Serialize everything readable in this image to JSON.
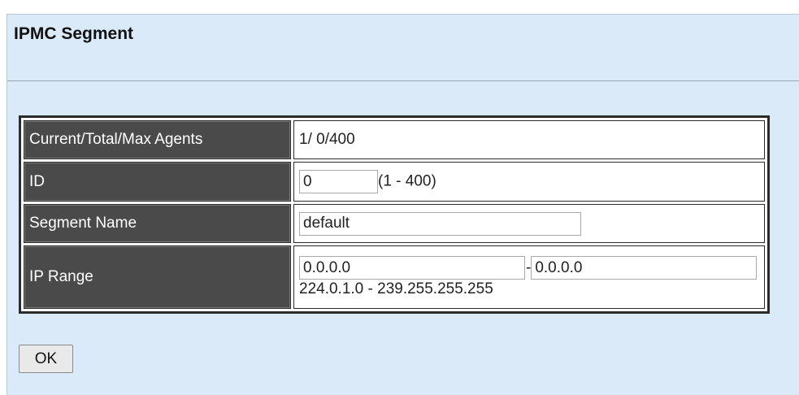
{
  "page": {
    "title": "IPMC Segment"
  },
  "form": {
    "agents": {
      "label": "Current/Total/Max Agents",
      "value": "1/ 0/400"
    },
    "id": {
      "label": "ID",
      "value": "0",
      "hint": "(1 - 400)"
    },
    "segment_name": {
      "label": "Segment Name",
      "value": "default"
    },
    "ip_range": {
      "label": "IP Range",
      "start": "0.0.0.0",
      "separator": "-",
      "end": "0.0.0.0",
      "hint": "224.0.1.0 - 239.255.255.255"
    }
  },
  "buttons": {
    "ok": "OK"
  }
}
